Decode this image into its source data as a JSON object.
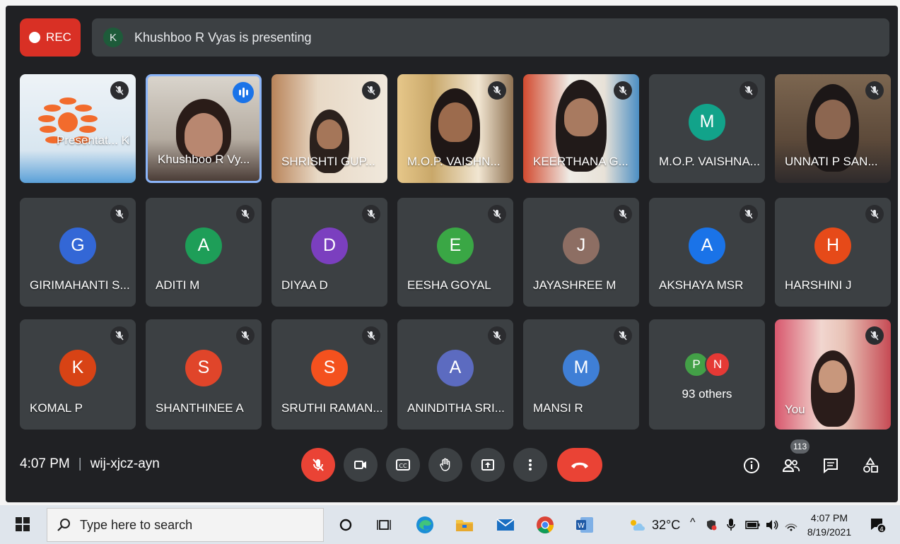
{
  "rec_label": "REC",
  "presenter": {
    "initial": "K",
    "text": "Khushboo R Vyas is presenting"
  },
  "row1": [
    {
      "name": "Presentat... Khushbo",
      "kind": "presentation"
    },
    {
      "name": "Khushboo R Vy...",
      "kind": "speaking"
    },
    {
      "name": "SHRISHTI GUP...",
      "kind": "video"
    },
    {
      "name": "M.O.P. VAISHN...",
      "kind": "video"
    },
    {
      "name": "KEERTHANA G...",
      "kind": "video"
    },
    {
      "name": "M.O.P. VAISHNA...",
      "kind": "avatar",
      "initial": "M",
      "color": "#12a38a"
    },
    {
      "name": "UNNATI P SAN...",
      "kind": "video"
    }
  ],
  "row2": [
    {
      "name": "GIRIMAHANTI S...",
      "initial": "G",
      "color": "#3367d6"
    },
    {
      "name": "ADITI M",
      "initial": "A",
      "color": "#1e9e58"
    },
    {
      "name": "DIYAA D",
      "initial": "D",
      "color": "#7b3fbf"
    },
    {
      "name": "EESHA GOYAL",
      "initial": "E",
      "color": "#3aa745"
    },
    {
      "name": "JAYASHREE M",
      "initial": "J",
      "color": "#8d6e63"
    },
    {
      "name": "AKSHAYA MSR",
      "initial": "A",
      "color": "#1a73e8"
    },
    {
      "name": "HARSHINI J",
      "initial": "H",
      "color": "#e64a19"
    }
  ],
  "row3": [
    {
      "name": "KOMAL P",
      "initial": "K",
      "color": "#d84315"
    },
    {
      "name": "SHANTHINEE A",
      "initial": "S",
      "color": "#e0452a"
    },
    {
      "name": "SRUTHI RAMAN...",
      "initial": "S",
      "color": "#f4511e"
    },
    {
      "name": "ANINDITHA SRI...",
      "initial": "A",
      "color": "#5c6bc0"
    },
    {
      "name": "MANSI R",
      "initial": "M",
      "color": "#3f7fd6"
    }
  ],
  "others": {
    "label": "93 others",
    "avatars": [
      {
        "initial": "P",
        "color": "#43a047"
      },
      {
        "initial": "N",
        "color": "#e53935"
      }
    ]
  },
  "you_label": "You",
  "meeting": {
    "time": "4:07 PM",
    "separator": "|",
    "code": "wij-xjcz-ayn"
  },
  "participants_count": "113",
  "taskbar": {
    "search_placeholder": "Type here to search",
    "temperature": "32°C",
    "clock_time": "4:07 PM",
    "clock_date": "8/19/2021",
    "notification_count": "4"
  }
}
